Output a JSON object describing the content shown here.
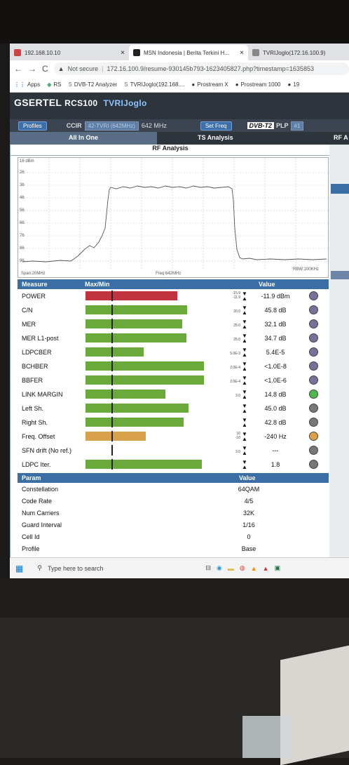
{
  "browser": {
    "tabs": [
      {
        "label": "192.168.10.10",
        "close": "×"
      },
      {
        "label": "MSN Indonesia | Berita Terkini H...",
        "close": "×"
      },
      {
        "label": "TVRIJoglo(172.16.100.9)",
        "close": ""
      }
    ],
    "security": "Not secure",
    "url": "172.16.100.9/resume-930145b793-1623405827.php?timestamp=1635853",
    "bookmarks": [
      "Apps",
      "RS",
      "DVB-T2 Analyzer",
      "TVRIJoglo(192.168....",
      "Prostream X",
      "Prostream 1000",
      "19"
    ]
  },
  "app": {
    "brand": "GSERTEL",
    "model": "RCS100",
    "channel": "TVRIJoglo",
    "profiles_button": "Profiles",
    "standard": "CCIR",
    "channel_select": "42-TVRI (642MHz)",
    "frequency": "642 MHz",
    "set_freq_button": "Set Freq",
    "dvb_badge": "DVB-T2",
    "plp_label": "PLP",
    "plp_select": "#1",
    "tabs": {
      "all_in_one": "All In One",
      "ts_analysis": "TS Analysis",
      "rf": "RF A"
    },
    "rf_analysis_title": "RF Analysis"
  },
  "spectrum": {
    "ref": "16 dBm",
    "y_ticks": [
      "26",
      "36",
      "46",
      "56",
      "66",
      "76",
      "86",
      "96"
    ],
    "span": "Span:20MHz",
    "freq": "Freq:642MHz",
    "rbw": "RBW:100KHz"
  },
  "measure": {
    "header": {
      "measure": "Measure",
      "maxmin": "Max/Min",
      "value": "Value"
    },
    "rows": [
      {
        "name": "POWER",
        "max": "-15.9",
        "min": "-11.9",
        "value": "-11.9 dBm",
        "fill": 0.71,
        "color": "#c0333f",
        "led": "#7a6f9a"
      },
      {
        "name": "C/N",
        "max": "",
        "min": "20.0",
        "value": "45.8 dB",
        "fill": 0.79,
        "color": "#6aaa3a",
        "led": "#7a6f9a"
      },
      {
        "name": "MER",
        "max": "",
        "min": "25.0",
        "value": "32.1 dB",
        "fill": 0.75,
        "color": "#6aaa3a",
        "led": "#7a6f9a"
      },
      {
        "name": "MER L1-post",
        "max": "",
        "min": "25.0",
        "value": "34.7 dB",
        "fill": 0.78,
        "color": "#6aaa3a",
        "led": "#7a6f9a"
      },
      {
        "name": "LDPCBER",
        "max": "",
        "min": "5.0E-3",
        "value": "5.4E-5",
        "fill": 0.45,
        "color": "#6aaa3a",
        "led": "#7a6f9a"
      },
      {
        "name": "BCHBER",
        "max": "",
        "min": "2.0E-4",
        "value": "<1.0E-8",
        "fill": 0.92,
        "color": "#6aaa3a",
        "led": "#7a6f9a"
      },
      {
        "name": "BBFER",
        "max": "",
        "min": "2.0E-4",
        "value": "<1.0E-6",
        "fill": 0.92,
        "color": "#6aaa3a",
        "led": "#7a6f9a"
      },
      {
        "name": "LINK MARGIN",
        "max": "",
        "min": "3.0",
        "value": "14.8 dB",
        "fill": 0.62,
        "color": "#6aaa3a",
        "led": "#4fb84a"
      },
      {
        "name": "Left Sh.",
        "max": "",
        "min": "",
        "value": "45.0 dB",
        "fill": 0.8,
        "color": "#6aaa3a",
        "led": "#777"
      },
      {
        "name": "Right Sh.",
        "max": "",
        "min": "",
        "value": "42.8 dB",
        "fill": 0.76,
        "color": "#6aaa3a",
        "led": "#777"
      },
      {
        "name": "Freq. Offset",
        "max": "10",
        "min": "-10",
        "value": "-240 Hz",
        "fill": 0.47,
        "color": "#d9a24a",
        "led": "#d9a24a"
      },
      {
        "name": "SFN drift (No ref.)",
        "max": "",
        "min": "3.0",
        "value": "---",
        "fill": 0.0,
        "color": "#6aaa3a",
        "led": "#777"
      },
      {
        "name": "LDPC Iter.",
        "max": "",
        "min": "",
        "value": "1.8",
        "fill": 0.9,
        "color": "#6aaa3a",
        "led": "#777"
      }
    ]
  },
  "params": {
    "header": {
      "param": "Param",
      "value": "Value"
    },
    "rows": [
      {
        "name": "Constellation",
        "value": "64QAM"
      },
      {
        "name": "Code Rate",
        "value": "4/5"
      },
      {
        "name": "Num Carriers",
        "value": "32K"
      },
      {
        "name": "Guard Interval",
        "value": "1/16"
      },
      {
        "name": "Cell Id",
        "value": "0"
      },
      {
        "name": "Profile",
        "value": "Base"
      }
    ]
  },
  "taskbar": {
    "search_placeholder": "Type here to search"
  }
}
